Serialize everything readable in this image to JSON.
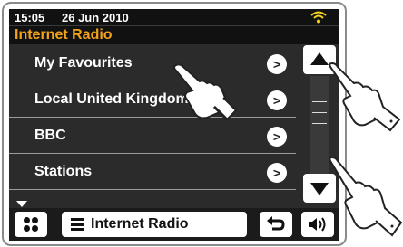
{
  "status": {
    "time": "15:05",
    "date": "26 Jun 2010",
    "wifi_icon": "wifi-icon"
  },
  "header": {
    "title": "Internet Radio"
  },
  "menu": {
    "items": [
      {
        "label": "My Favourites"
      },
      {
        "label": "Local United Kingdom"
      },
      {
        "label": "BBC"
      },
      {
        "label": "Stations"
      }
    ],
    "arrow_glyph": ">"
  },
  "bottom": {
    "source_label": "Internet Radio"
  },
  "colors": {
    "accent": "#f3a31b",
    "screen": "#2b2b2b",
    "bar": "#111111"
  }
}
